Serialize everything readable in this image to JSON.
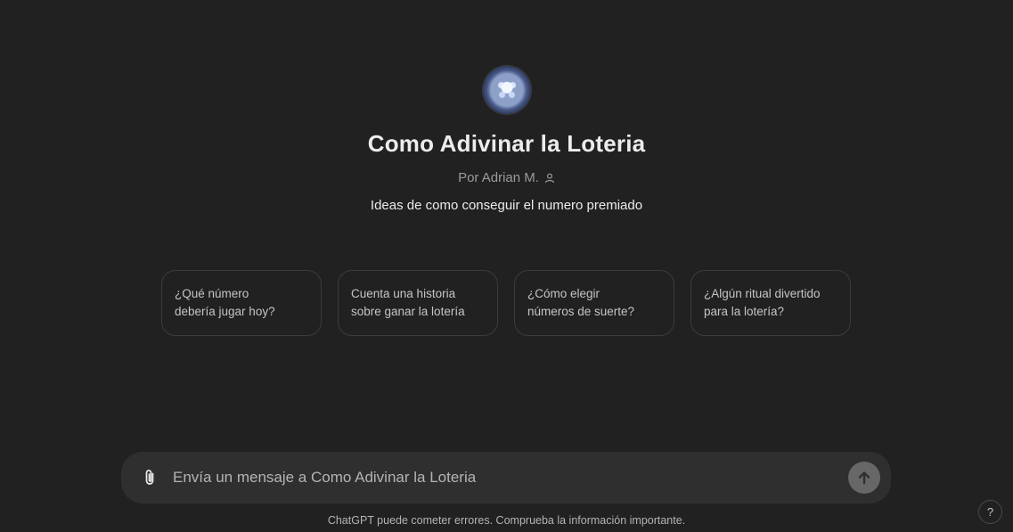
{
  "gpt": {
    "name": "Como Adivinar la Loteria",
    "author": "Por Adrian M.",
    "description": "Ideas de como conseguir el numero premiado"
  },
  "suggestions": [
    {
      "line1": "¿Qué número",
      "line2": "debería jugar hoy?"
    },
    {
      "line1": "Cuenta una historia",
      "line2": "sobre ganar la lotería"
    },
    {
      "line1": "¿Cómo elegir",
      "line2": "números de suerte?"
    },
    {
      "line1": "¿Algún ritual divertido",
      "line2": "para la lotería?"
    }
  ],
  "composer": {
    "placeholder": "Envía un mensaje a Como Adivinar la Loteria"
  },
  "footer": {
    "disclaimer": "ChatGPT puede cometer errores. Comprueba la información importante.",
    "help_label": "?"
  },
  "icons": {
    "attach": "paperclip-icon",
    "send": "arrow-up-icon",
    "author": "person-icon"
  },
  "colors": {
    "background": "#212121",
    "composer": "#2f2f2f",
    "send_button": "#676767"
  }
}
